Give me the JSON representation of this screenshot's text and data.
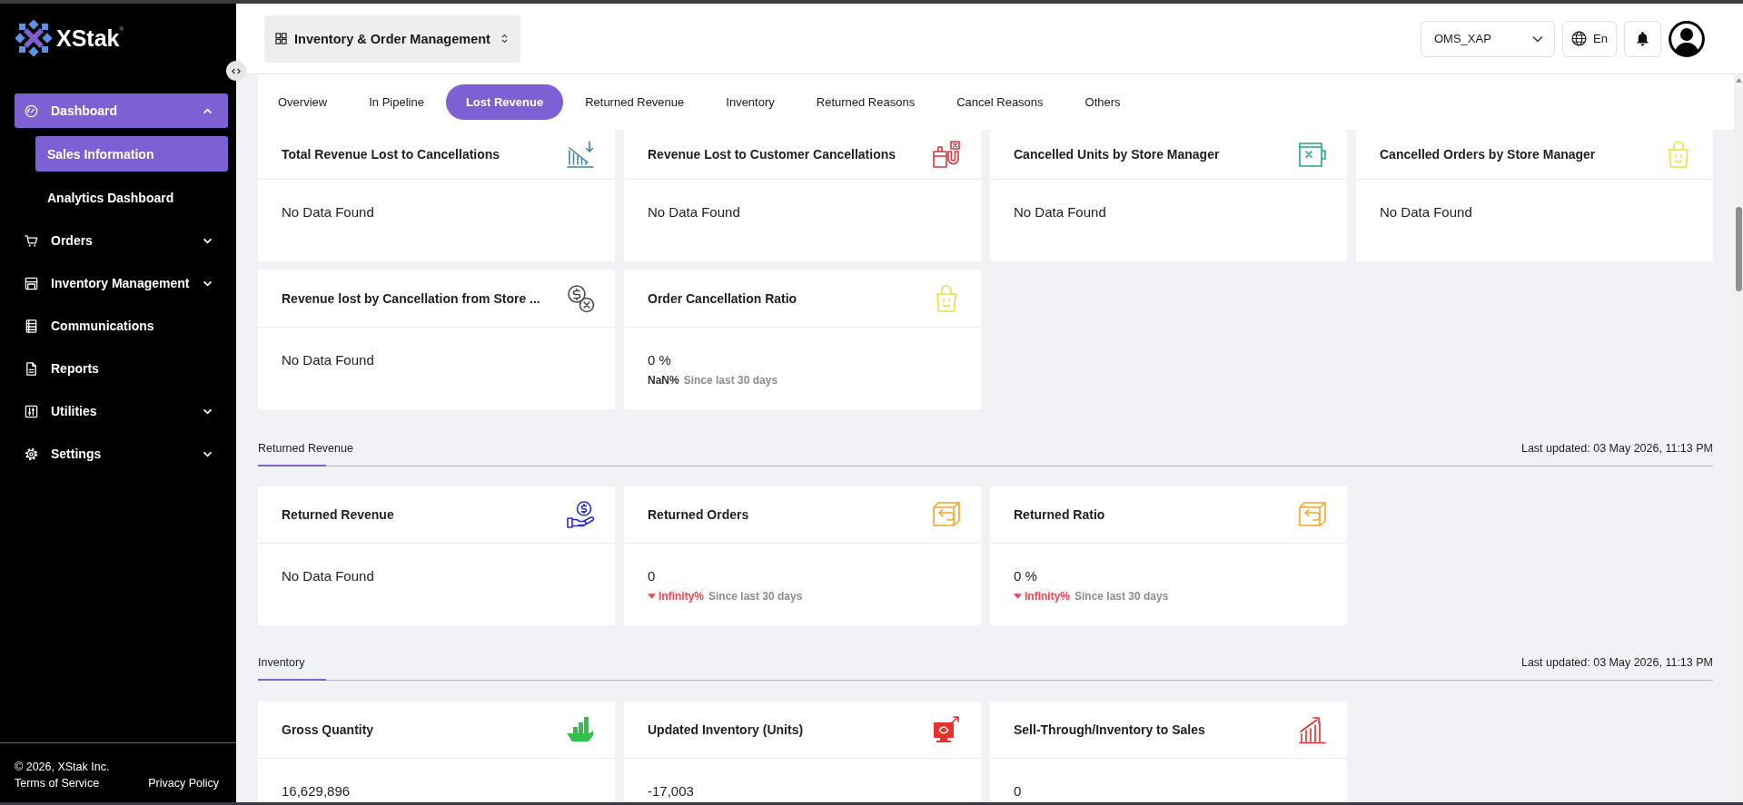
{
  "sidebar": {
    "logo": {
      "name": "XStak",
      "mark": "®"
    },
    "items": [
      {
        "label": "Dashboard",
        "kind": "group",
        "expanded": true,
        "selected": true,
        "children": [
          {
            "label": "Sales Information",
            "selected": true
          },
          {
            "label": "Analytics Dashboard",
            "selected": false
          }
        ]
      },
      {
        "label": "Orders",
        "kind": "group",
        "expanded": false,
        "selected": false
      },
      {
        "label": "Inventory Management",
        "kind": "group",
        "expanded": false,
        "selected": false
      },
      {
        "label": "Communications",
        "kind": "link",
        "selected": false
      },
      {
        "label": "Reports",
        "kind": "link",
        "selected": false
      },
      {
        "label": "Utilities",
        "kind": "group",
        "expanded": false,
        "selected": false
      },
      {
        "label": "Settings",
        "kind": "group",
        "expanded": false,
        "selected": false
      }
    ],
    "footer": {
      "copyright": "© 2026, XStak Inc.",
      "links": [
        "Terms of Service",
        "Privacy Policy"
      ]
    }
  },
  "header": {
    "module": "Inventory & Order Management",
    "store": "OMS_XAP",
    "language": "En"
  },
  "tabs": [
    {
      "label": "Overview",
      "selected": false
    },
    {
      "label": "In Pipeline",
      "selected": false
    },
    {
      "label": "Lost Revenue",
      "selected": true
    },
    {
      "label": "Returned Revenue",
      "selected": false
    },
    {
      "label": "Inventory",
      "selected": false
    },
    {
      "label": "Returned Reasons",
      "selected": false
    },
    {
      "label": "Cancel Reasons",
      "selected": false
    },
    {
      "label": "Others",
      "selected": false
    }
  ],
  "sections": [
    {
      "cards": [
        {
          "title": "Total Revenue Lost to Cancellations",
          "value": "No Data Found"
        },
        {
          "title": "Revenue Lost to Customer Cancellations",
          "value": "No Data Found"
        },
        {
          "title": "Cancelled Units by Store Manager",
          "value": "No Data Found"
        },
        {
          "title": "Cancelled Orders by Store Manager",
          "value": "No Data Found"
        },
        {
          "title": "Revenue lost by Cancellation from Store ...",
          "value": "No Data Found"
        },
        {
          "title": "Order Cancellation Ratio",
          "value": "0 %",
          "change": "NaN%",
          "decline": false,
          "period": "Since last 30 days"
        }
      ]
    },
    {
      "title": "Returned Revenue",
      "updated": "Last updated: 03 May 2026, 11:13 PM",
      "cards": [
        {
          "title": "Returned Revenue",
          "value": "No Data Found"
        },
        {
          "title": "Returned Orders",
          "value": "0",
          "change": "Infinity%",
          "decline": true,
          "period": "Since last 30 days"
        },
        {
          "title": "Returned Ratio",
          "value": "0 %",
          "change": "Infinity%",
          "decline": true,
          "period": "Since last 30 days"
        }
      ]
    },
    {
      "title": "Inventory",
      "updated": "Last updated: 03 May 2026, 11:13 PM",
      "cards": [
        {
          "title": "Gross Quantity",
          "value": "16,629,896"
        },
        {
          "title": "Updated Inventory (Units)",
          "value": "-17,003"
        },
        {
          "title": "Sell-Through/Inventory to Sales",
          "value": "0"
        }
      ]
    }
  ]
}
